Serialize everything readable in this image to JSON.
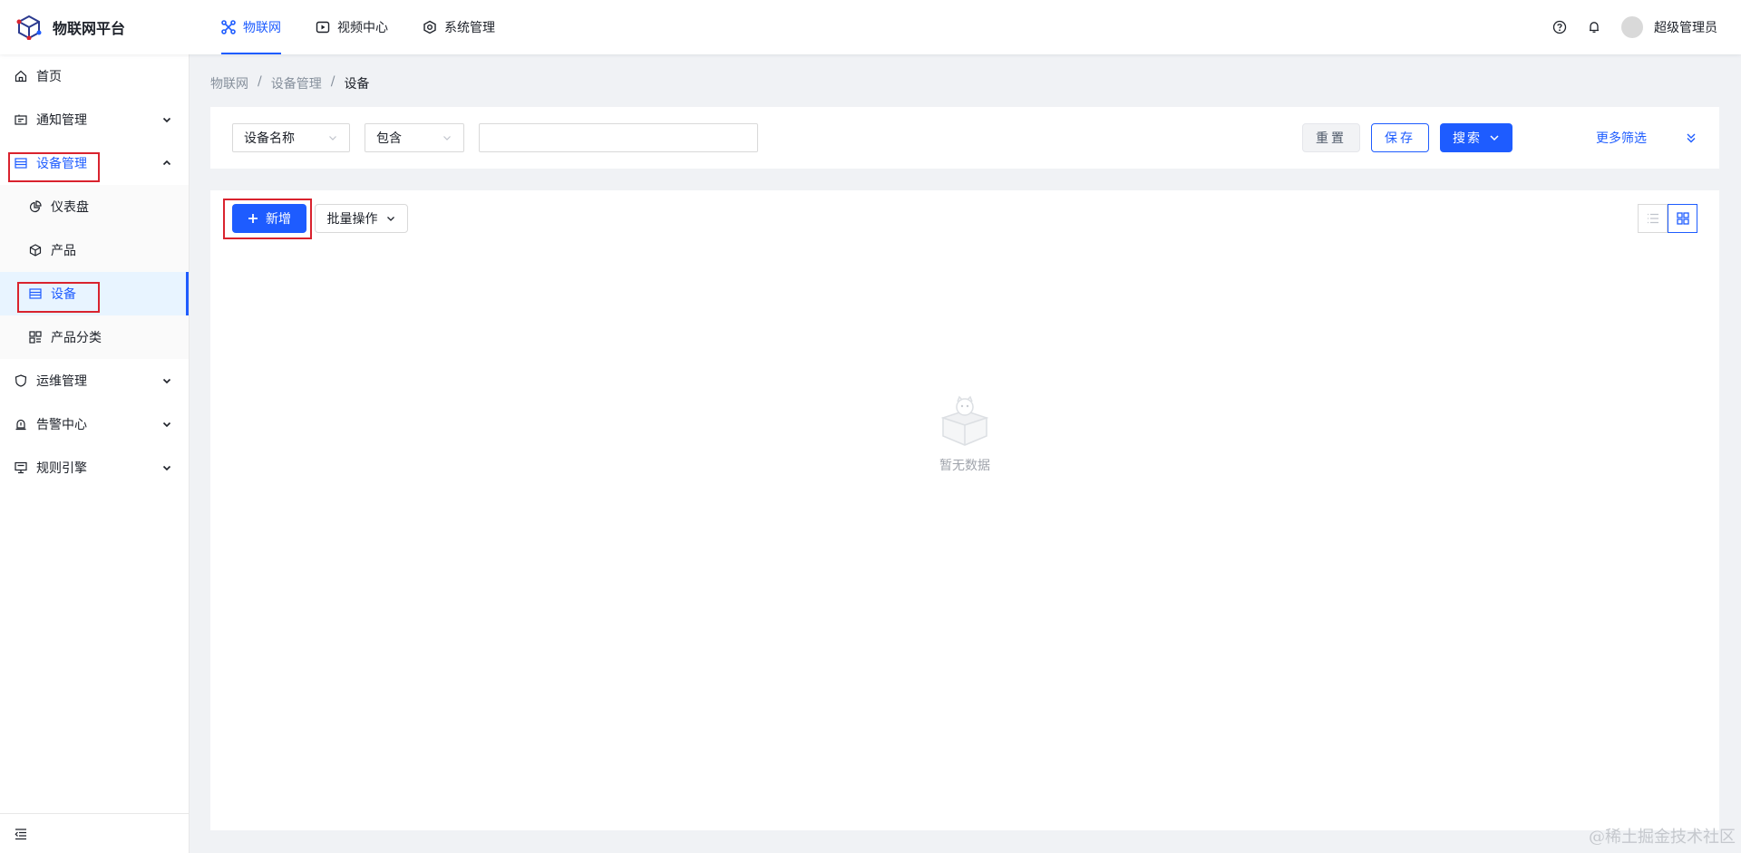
{
  "app": {
    "title": "物联网平台"
  },
  "topnav": [
    {
      "label": "物联网",
      "icon": "iot-icon",
      "active": true
    },
    {
      "label": "视频中心",
      "icon": "video-icon",
      "active": false
    },
    {
      "label": "系统管理",
      "icon": "system-icon",
      "active": false
    }
  ],
  "user": {
    "name": "超级管理员"
  },
  "sidebar": {
    "home": "首页",
    "notify": "通知管理",
    "device_mgmt": "设备管理",
    "dashboard": "仪表盘",
    "product": "产品",
    "device": "设备",
    "product_category": "产品分类",
    "ops": "运维管理",
    "alarm": "告警中心",
    "rules": "规则引擎"
  },
  "breadcrumb": {
    "level1": "物联网",
    "level2": "设备管理",
    "level3": "设备",
    "sep": "/"
  },
  "filter": {
    "field": "设备名称",
    "operator": "包含",
    "value": "",
    "reset": "重置",
    "save": "保存",
    "search": "搜索",
    "more": "更多筛选"
  },
  "toolbar": {
    "add": "新增",
    "batch": "批量操作"
  },
  "empty": {
    "text": "暂无数据"
  },
  "watermark": "@稀土掘金技术社区",
  "colors": {
    "primary": "#1e5cff",
    "highlight": "#d9232e",
    "selected_bg": "#e8f4ff"
  }
}
